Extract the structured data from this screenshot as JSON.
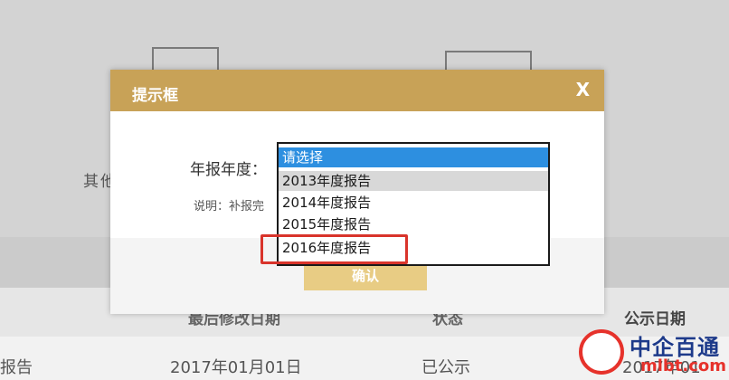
{
  "modal": {
    "title": "提示框",
    "close_label": "X",
    "field_label": "年报年度：",
    "note": "说明：补报完",
    "confirm_label": "确认"
  },
  "dropdown": {
    "options": [
      {
        "label": "请选择",
        "state": "selected"
      },
      {
        "label": "2013年度报告",
        "state": "hover"
      },
      {
        "label": "2014年度报告",
        "state": "normal"
      },
      {
        "label": "2015年度报告",
        "state": "normal"
      },
      {
        "label": "2016年度报告",
        "state": "highlighted"
      }
    ]
  },
  "background": {
    "side_label": "其他",
    "table": {
      "headers": [
        "最后修改日期",
        "状态",
        "公示日期"
      ],
      "row": [
        "报告",
        "2017年01月01日",
        "已公示",
        "2017年01"
      ]
    }
  },
  "watermark": {
    "brand": "中企百通",
    "url": "mlbt.com"
  },
  "colors": {
    "header_gold": "#c8a257",
    "selected_blue": "#2d8fe0",
    "highlight_red": "#d9342b",
    "button_gold": "#e8cc84"
  }
}
